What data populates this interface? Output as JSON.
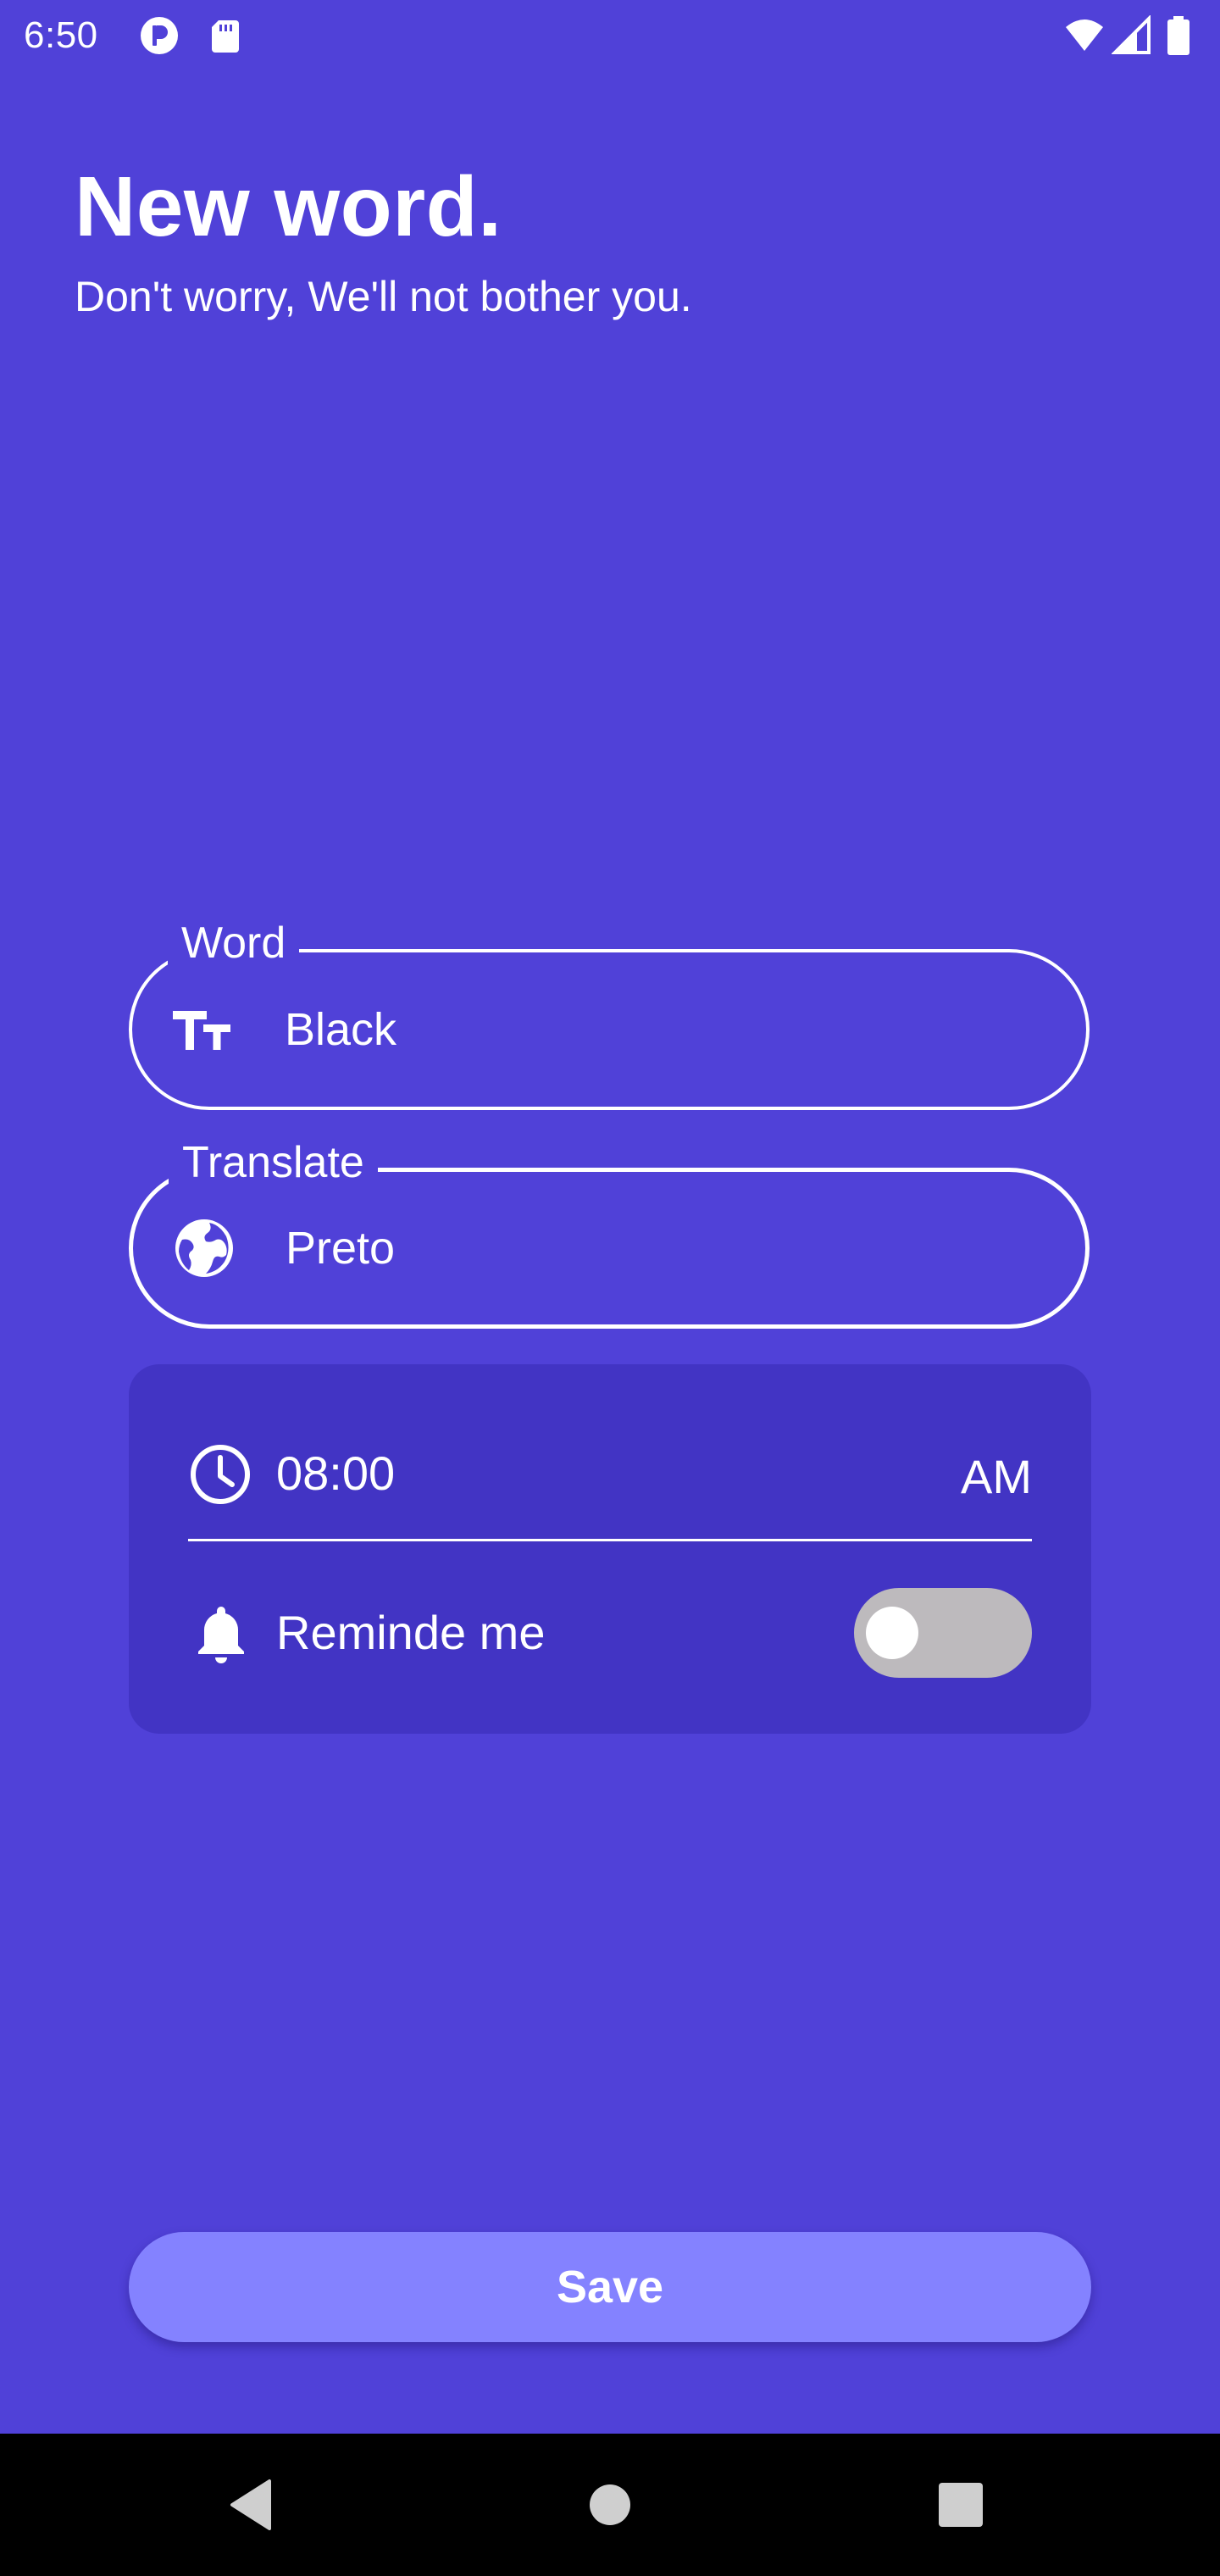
{
  "status_bar": {
    "time": "6:50",
    "left_icons": [
      "p-app-icon",
      "sd-card-icon"
    ],
    "right_icons": [
      "wifi-icon",
      "cell-signal-icon",
      "battery-icon"
    ]
  },
  "header": {
    "title": "New word.",
    "subtitle": "Don't worry, We'll not bother you."
  },
  "form": {
    "word": {
      "label": "Word",
      "value": "Black",
      "icon": "text-size-icon"
    },
    "translate": {
      "label": "Translate",
      "value": "Preto",
      "icon": "globe-icon"
    },
    "reminder": {
      "time": "08:00",
      "period": "AM",
      "label": "Reminde me",
      "enabled": false
    }
  },
  "save_label": "Save",
  "nav_bar": {
    "buttons": [
      "back-icon",
      "home-icon",
      "recents-icon"
    ]
  },
  "colors": {
    "background": "#5041d8",
    "card": "#4234c4",
    "button": "#8482ff",
    "toggle_track_off": "#bdbabd",
    "text": "#ffffff"
  }
}
